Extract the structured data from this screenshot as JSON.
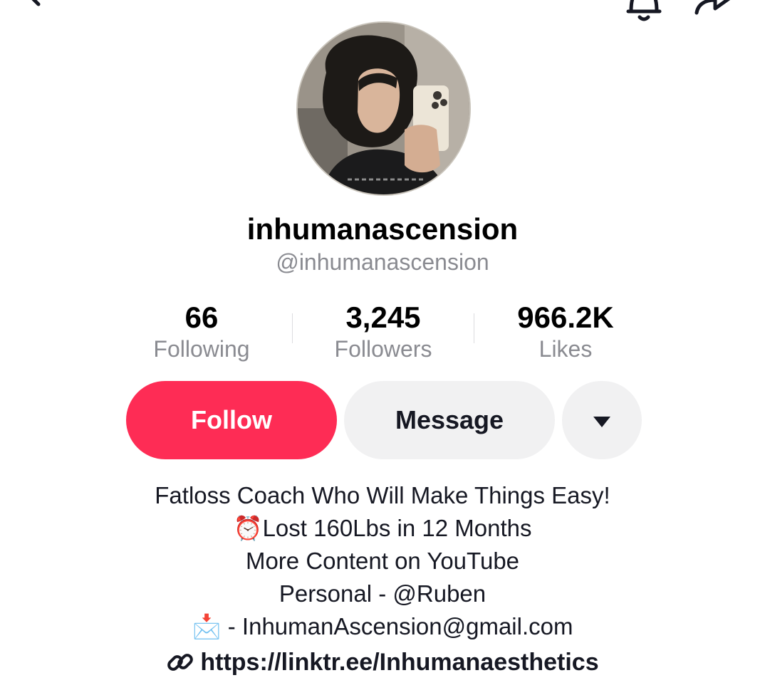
{
  "header": {
    "back_icon": "arrow-left-icon",
    "notification_icon": "bell-icon",
    "share_icon": "share-arrow-icon"
  },
  "profile": {
    "display_name": "inhumanascension",
    "username": "@inhumanascension"
  },
  "stats": [
    {
      "value": "66",
      "label": "Following"
    },
    {
      "value": "3,245",
      "label": "Followers"
    },
    {
      "value": "966.2K",
      "label": "Likes"
    }
  ],
  "actions": {
    "follow_label": "Follow",
    "message_label": "Message",
    "more_icon": "caret-down-icon"
  },
  "bio": {
    "lines": [
      "Fatloss Coach Who Will Make Things Easy!",
      "⏰Lost 160Lbs in 12 Months",
      "More Content on YouTube",
      "Personal - @Ruben",
      "📩 - InhumanAscension@gmail.com"
    ],
    "link_icon": "link-icon",
    "link": "https://linktr.ee/Inhumanaesthetics"
  },
  "colors": {
    "follow": "#fe2c55",
    "secondary_button": "#f1f1f2",
    "muted_text": "#8a8b91"
  }
}
